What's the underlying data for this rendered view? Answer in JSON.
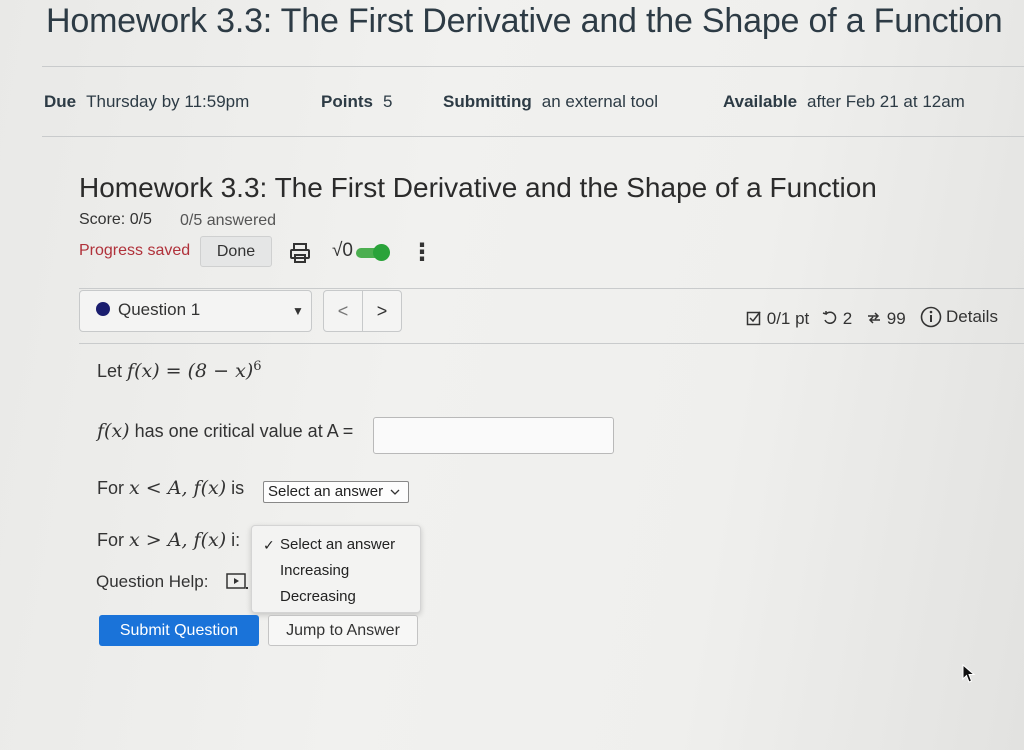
{
  "page": {
    "title": "Homework 3.3: The First Derivative and the Shape of a Function"
  },
  "meta": {
    "due_label": "Due",
    "due_value": "Thursday by 11:59pm",
    "points_label": "Points",
    "points_value": "5",
    "submitting_label": "Submitting",
    "submitting_value": "an external tool",
    "available_label": "Available",
    "available_value": "after Feb 21 at 12am"
  },
  "homework": {
    "title": "Homework 3.3: The First Derivative and the Shape of a Function",
    "score": "Score: 0/5",
    "answered": "0/5 answered",
    "progress_saved": "Progress saved",
    "done_label": "Done",
    "sqrt_label": "√0"
  },
  "question_nav": {
    "current": "Question 1",
    "prev": "<",
    "next": ">",
    "points": "0/1 pt",
    "retries": "2",
    "attempts": "99",
    "details": "Details"
  },
  "question": {
    "let_prefix": "Let",
    "function": "f(x) = (8 − x)",
    "exponent": "6",
    "crit_fx": "f(x)",
    "crit_text": "has one critical value at A =",
    "crit_value": "",
    "for_label": "For",
    "less_expr": "x < A, f(x)",
    "greater_expr": "x > A, f(x)",
    "is_label": "is",
    "is_clipped": "i:",
    "select1_value": "Select an answer",
    "dropdown_options": [
      "Select an answer",
      "Increasing",
      "Decreasing"
    ],
    "help_label": "Question Help:"
  },
  "actions": {
    "submit": "Submit Question",
    "jump": "Jump to Answer"
  },
  "colors": {
    "submit_bg": "#1a73d9",
    "progress_saved": "#b0313a",
    "toggle": "#2aa33a",
    "question_dot": "#1a1d6e"
  },
  "icons": [
    "print-icon",
    "more-icon",
    "chevron-down-icon",
    "checkbox-icon",
    "retry-icon",
    "attempts-icon",
    "info-icon",
    "video-icon",
    "check-icon",
    "mouse-cursor-icon"
  ]
}
